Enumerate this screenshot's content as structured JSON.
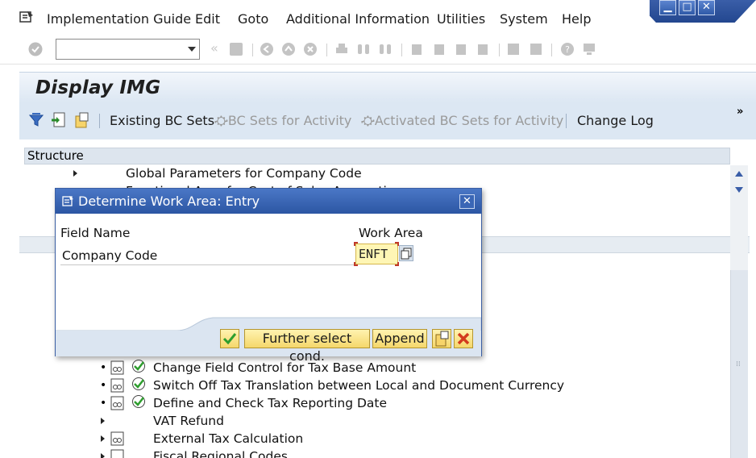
{
  "menubar": {
    "items": [
      {
        "label": "Implementation Guide"
      },
      {
        "label": "Edit"
      },
      {
        "label": "Goto"
      },
      {
        "label": "Additional Information"
      },
      {
        "label": "Utilities"
      },
      {
        "label": "System"
      },
      {
        "label": "Help"
      }
    ]
  },
  "window_controls": [
    "minimize-icon",
    "maximize-icon",
    "close-icon"
  ],
  "command_field": {
    "value": ""
  },
  "title": "Display IMG",
  "app_toolbar": {
    "existing_bc_sets": "Existing BC Sets",
    "bc_sets_for_activity": "BC Sets for Activity",
    "activated_bc_sets": "Activated BC Sets for Activity",
    "change_log": "Change Log",
    "more": "»"
  },
  "tree": {
    "header": "Structure",
    "rows": [
      {
        "label": "Global Parameters for Company Code",
        "kind": "folder"
      },
      {
        "label": "Functional Area for Cost of Sales Accounting",
        "kind": "folder"
      },
      {
        "label": "Change Field Control for Tax Base Amount",
        "kind": "activity"
      },
      {
        "label": "Switch Off Tax Translation between Local and Document Currency",
        "kind": "activity"
      },
      {
        "label": "Define and Check Tax Reporting Date",
        "kind": "activity"
      },
      {
        "label": "VAT Refund",
        "kind": "folder"
      },
      {
        "label": "External Tax Calculation",
        "kind": "folder-doc"
      },
      {
        "label": "Fiscal Regional Codes",
        "kind": "folder-doc"
      }
    ]
  },
  "dialog": {
    "title": "Determine Work Area: Entry",
    "col_field_name": "Field Name",
    "col_work_area": "Work Area",
    "field_label": "Company Code",
    "field_value": "ENFT",
    "buttons": {
      "further": "Further select cond.",
      "append": "Append"
    }
  },
  "colors": {
    "dialog_titlebar": "#2c56a3",
    "app_toolbar_bg": "#dce7f3",
    "button_yellow": "#f5d76b",
    "input_yellow": "#fff6b5"
  }
}
